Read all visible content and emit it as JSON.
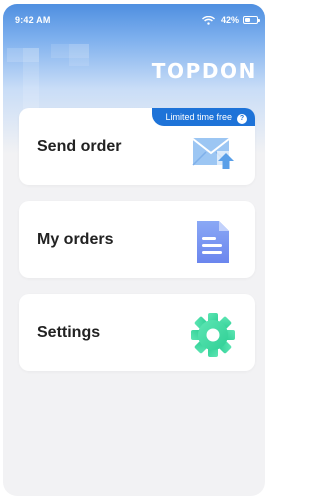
{
  "status_bar": {
    "time": "9:42 AM",
    "battery_percent": "42%",
    "battery_level": 0.42,
    "icons": [
      "wifi-icon",
      "battery-icon"
    ]
  },
  "brand": {
    "logo_text": "TOPDON"
  },
  "menu": [
    {
      "label": "Send order",
      "icon": "mail-upload-icon",
      "badge": "Limited time free",
      "badge_icon": "?"
    },
    {
      "label": "My orders",
      "icon": "document-icon"
    },
    {
      "label": "Settings",
      "icon": "gear-icon"
    }
  ],
  "colors": {
    "header_blue": "#4f8fe0",
    "badge_blue": "#1e73d8",
    "mail_icon": "#7fb6ee",
    "document_icon": "#6f8ff0",
    "gear_icon": "#3ed8a0",
    "background": "#f2f2f4"
  }
}
